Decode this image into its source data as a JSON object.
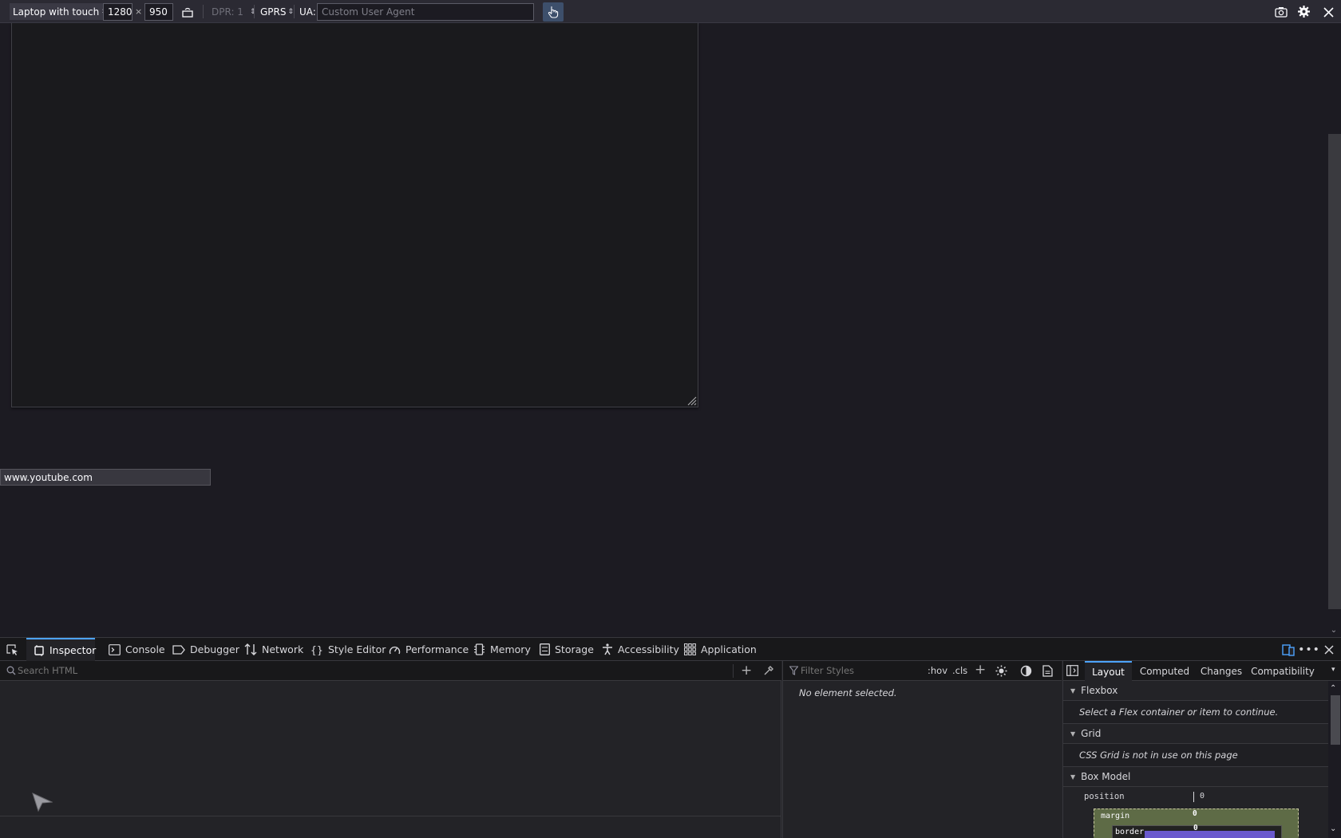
{
  "rdm": {
    "device": "Laptop with touch",
    "width": "1280",
    "times": "×",
    "height": "950",
    "dpr": "DPR: 1",
    "throttle": "GPRS",
    "ua_label": "UA:",
    "ua_placeholder": "Custom User Agent"
  },
  "status_url": "www.youtube.com",
  "devtools": {
    "tabs": [
      {
        "label": "Inspector",
        "icon": "inspector-icon",
        "active": true
      },
      {
        "label": "Console",
        "icon": "console-icon"
      },
      {
        "label": "Debugger",
        "icon": "debugger-icon"
      },
      {
        "label": "Network",
        "icon": "network-icon"
      },
      {
        "label": "Style Editor",
        "icon": "style-editor-icon"
      },
      {
        "label": "Performance",
        "icon": "performance-icon"
      },
      {
        "label": "Memory",
        "icon": "memory-icon"
      },
      {
        "label": "Storage",
        "icon": "storage-icon"
      },
      {
        "label": "Accessibility",
        "icon": "accessibility-icon"
      },
      {
        "label": "Application",
        "icon": "application-icon"
      }
    ],
    "search_html_placeholder": "Search HTML",
    "filter_styles_placeholder": "Filter Styles",
    "hov": ":hov",
    "cls": ".cls",
    "no_element": "No element selected.",
    "side_tabs": [
      "Layout",
      "Computed",
      "Changes",
      "Compatibility"
    ],
    "flexbox_title": "Flexbox",
    "flexbox_msg": "Select a Flex container or item to continue.",
    "grid_title": "Grid",
    "grid_msg": "CSS Grid is not in use on this page",
    "boxmodel_title": "Box Model",
    "position_label": "position",
    "position_value": "0",
    "margin_label": "margin",
    "margin_value": "0",
    "border_label": "border",
    "border_value": "0"
  },
  "colors": {
    "accent": "#4da3ff",
    "margin_box": "#5e6b46",
    "border_box": "#222222",
    "padding_box": "#6a5acd"
  }
}
